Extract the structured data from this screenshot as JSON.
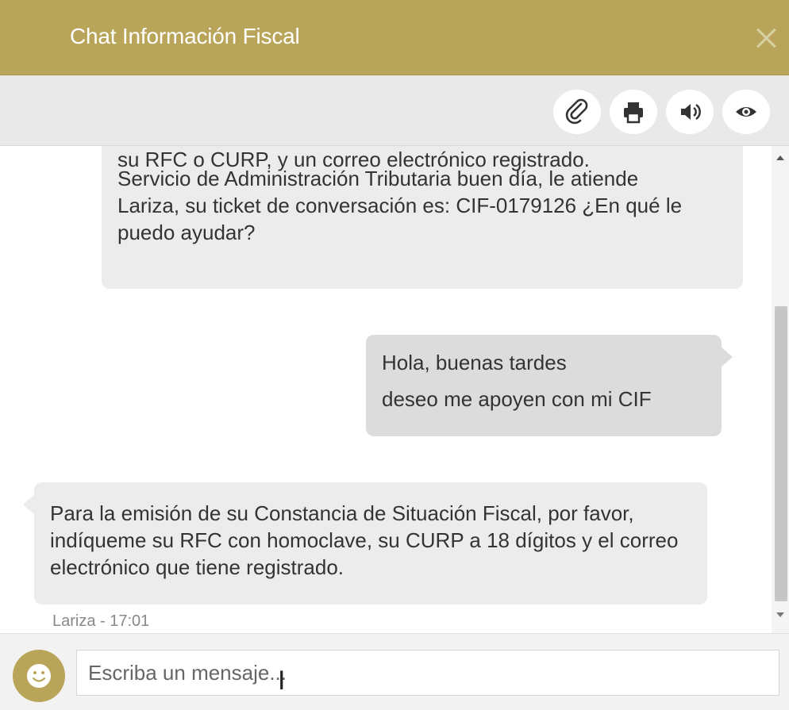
{
  "window": {
    "title": "Chat Información Fiscal"
  },
  "toolbar": {
    "buttons": [
      {
        "icon": "paperclip-icon"
      },
      {
        "icon": "print-icon"
      },
      {
        "icon": "speaker-icon"
      },
      {
        "icon": "eye-icon"
      }
    ]
  },
  "messages": [
    {
      "side": "agent",
      "lines": [
        "su RFC o CURP, y un correo electrónico registrado.",
        "Servicio de Administración Tributaria buen día, le atiende Lariza, su ticket de conversación es: CIF-0179126 ¿En qué le puedo ayudar?"
      ]
    },
    {
      "side": "user",
      "lines": [
        "Hola, buenas tardes",
        "deseo me apoyen con mi CIF"
      ]
    },
    {
      "side": "agent",
      "lines": [
        "Para la emisión de su Constancia de Situación Fiscal, por favor, indíqueme su RFC con homoclave, su CURP a 18 dígitos y el correo electrónico que tiene registrado."
      ],
      "meta": "Lariza - 17:01"
    }
  ],
  "composer": {
    "placeholder": "Escriba un mensaje..."
  },
  "colors": {
    "brand": "#b9a55a",
    "bubble": "#ececec",
    "user_bubble": "#dcdcdc"
  }
}
